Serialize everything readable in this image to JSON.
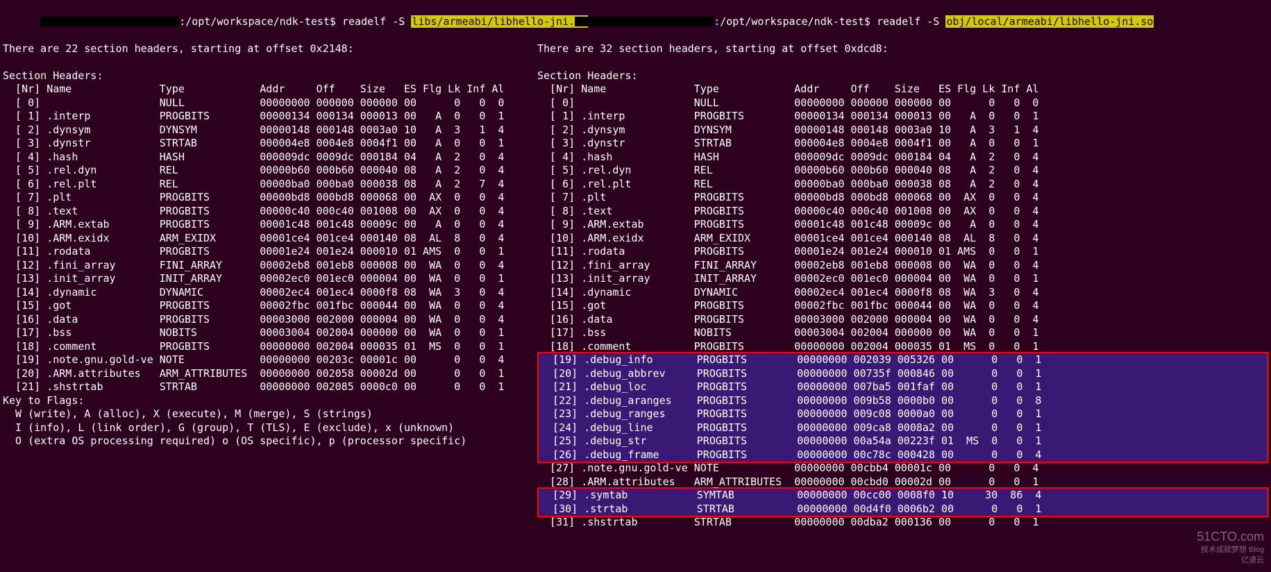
{
  "left": {
    "prompt_path": ":/opt/workspace/ndk-test$ ",
    "command": "readelf -S ",
    "file_arg": "libs/armeabi/libhello-jni.so",
    "summary": "There are 22 section headers, starting at offset 0x2148:",
    "heading": "Section Headers:",
    "columns": "  [Nr] Name              Type            Addr     Off    Size   ES Flg Lk Inf Al",
    "rows": [
      "  [ 0]                   NULL            00000000 000000 000000 00      0   0  0",
      "  [ 1] .interp           PROGBITS        00000134 000134 000013 00   A  0   0  1",
      "  [ 2] .dynsym           DYNSYM          00000148 000148 0003a0 10   A  3   1  4",
      "  [ 3] .dynstr           STRTAB          000004e8 0004e8 0004f1 00   A  0   0  1",
      "  [ 4] .hash             HASH            000009dc 0009dc 000184 04   A  2   0  4",
      "  [ 5] .rel.dyn          REL             00000b60 000b60 000040 08   A  2   0  4",
      "  [ 6] .rel.plt          REL             00000ba0 000ba0 000038 08   A  2   7  4",
      "  [ 7] .plt              PROGBITS        00000bd8 000bd8 000068 00  AX  0   0  4",
      "  [ 8] .text             PROGBITS        00000c40 000c40 001008 00  AX  0   0  4",
      "  [ 9] .ARM.extab        PROGBITS        00001c48 001c48 00009c 00   A  0   0  4",
      "  [10] .ARM.exidx        ARM_EXIDX       00001ce4 001ce4 000140 08  AL  8   0  4",
      "  [11] .rodata           PROGBITS        00001e24 001e24 000010 01 AMS  0   0  1",
      "  [12] .fini_array       FINI_ARRAY      00002eb8 001eb8 000008 00  WA  0   0  4",
      "  [13] .init_array       INIT_ARRAY      00002ec0 001ec0 000004 00  WA  0   0  1",
      "  [14] .dynamic          DYNAMIC         00002ec4 001ec4 0000f8 08  WA  3   0  4",
      "  [15] .got              PROGBITS        00002fbc 001fbc 000044 00  WA  0   0  4",
      "  [16] .data             PROGBITS        00003000 002000 000004 00  WA  0   0  4",
      "  [17] .bss              NOBITS          00003004 002004 000000 00  WA  0   0  1",
      "  [18] .comment          PROGBITS        00000000 002004 000035 01  MS  0   0  1",
      "  [19] .note.gnu.gold-ve NOTE            00000000 00203c 00001c 00      0   0  4",
      "  [20] .ARM.attributes   ARM_ATTRIBUTES  00000000 002058 00002d 00      0   0  1",
      "  [21] .shstrtab         STRTAB          00000000 002085 0000c0 00      0   0  1"
    ],
    "key_heading": "Key to Flags:",
    "key_lines": [
      "  W (write), A (alloc), X (execute), M (merge), S (strings)",
      "  I (info), L (link order), G (group), T (TLS), E (exclude), x (unknown)",
      "  O (extra OS processing required) o (OS specific), p (processor specific)"
    ]
  },
  "right": {
    "prompt_path": ":/opt/workspace/ndk-test$ ",
    "command": "readelf -S ",
    "file_arg": "obj/local/armeabi/libhello-jni.so",
    "summary": "There are 32 section headers, starting at offset 0xdcd8:",
    "heading": "Section Headers:",
    "columns": "  [Nr] Name              Type            Addr     Off    Size   ES Flg Lk Inf Al",
    "rows_top": [
      "  [ 0]                   NULL            00000000 000000 000000 00      0   0  0",
      "  [ 1] .interp           PROGBITS        00000134 000134 000013 00   A  0   0  1",
      "  [ 2] .dynsym           DYNSYM          00000148 000148 0003a0 10   A  3   1  4",
      "  [ 3] .dynstr           STRTAB          000004e8 0004e8 0004f1 00   A  0   0  1",
      "  [ 4] .hash             HASH            000009dc 0009dc 000184 04   A  2   0  4",
      "  [ 5] .rel.dyn          REL             00000b60 000b60 000040 08   A  2   0  4",
      "  [ 6] .rel.plt          REL             00000ba0 000ba0 000038 08   A  2   0  4",
      "  [ 7] .plt              PROGBITS        00000bd8 000bd8 000068 00  AX  0   0  4",
      "  [ 8] .text             PROGBITS        00000c40 000c40 001008 00  AX  0   0  4",
      "  [ 9] .ARM.extab        PROGBITS        00001c48 001c48 00009c 00   A  0   0  4",
      "  [10] .ARM.exidx        ARM_EXIDX       00001ce4 001ce4 000140 08  AL  8   0  4",
      "  [11] .rodata           PROGBITS        00001e24 001e24 000010 01 AMS  0   0  1",
      "  [12] .fini_array       FINI_ARRAY      00002eb8 001eb8 000008 00  WA  0   0  4",
      "  [13] .init_array       INIT_ARRAY      00002ec0 001ec0 000004 00  WA  0   0  1",
      "  [14] .dynamic          DYNAMIC         00002ec4 001ec4 0000f8 08  WA  3   0  4",
      "  [15] .got              PROGBITS        00002fbc 001fbc 000044 00  WA  0   0  4",
      "  [16] .data             PROGBITS        00003000 002000 000004 00  WA  0   0  4",
      "  [17] .bss              NOBITS          00003004 002004 000000 00  WA  0   0  1",
      "  [18] .comment          PROGBITS        00000000 002004 000035 01  MS  0   0  1"
    ],
    "rows_box1": [
      "  [19] .debug_info       PROGBITS        00000000 002039 005326 00      0   0  1",
      "  [20] .debug_abbrev     PROGBITS        00000000 00735f 000846 00      0   0  1",
      "  [21] .debug_loc        PROGBITS        00000000 007ba5 001faf 00      0   0  1",
      "  [22] .debug_aranges    PROGBITS        00000000 009b58 0000b0 00      0   0  8",
      "  [23] .debug_ranges     PROGBITS        00000000 009c08 0000a0 00      0   0  1",
      "  [24] .debug_line       PROGBITS        00000000 009ca8 0008a2 00      0   0  1",
      "  [25] .debug_str        PROGBITS        00000000 00a54a 00223f 01  MS  0   0  1",
      "  [26] .debug_frame      PROGBITS        00000000 00c78c 000428 00      0   0  4"
    ],
    "rows_mid": [
      "  [27] .note.gnu.gold-ve NOTE            00000000 00cbb4 00001c 00      0   0  4",
      "  [28] .ARM.attributes   ARM_ATTRIBUTES  00000000 00cbd0 00002d 00      0   0  1"
    ],
    "rows_box2": [
      "  [29] .symtab           SYMTAB          00000000 00cc00 0008f0 10     30  86  4",
      "  [30] .strtab           STRTAB          00000000 00d4f0 0006b2 00      0   0  1"
    ],
    "rows_bottom": [
      "  [31] .shstrtab         STRTAB          00000000 00dba2 000136 00      0   0  1"
    ]
  },
  "watermark": {
    "main": "51CTO.com",
    "sub": "技术成就梦想  Blog",
    "brand": "亿速云"
  }
}
